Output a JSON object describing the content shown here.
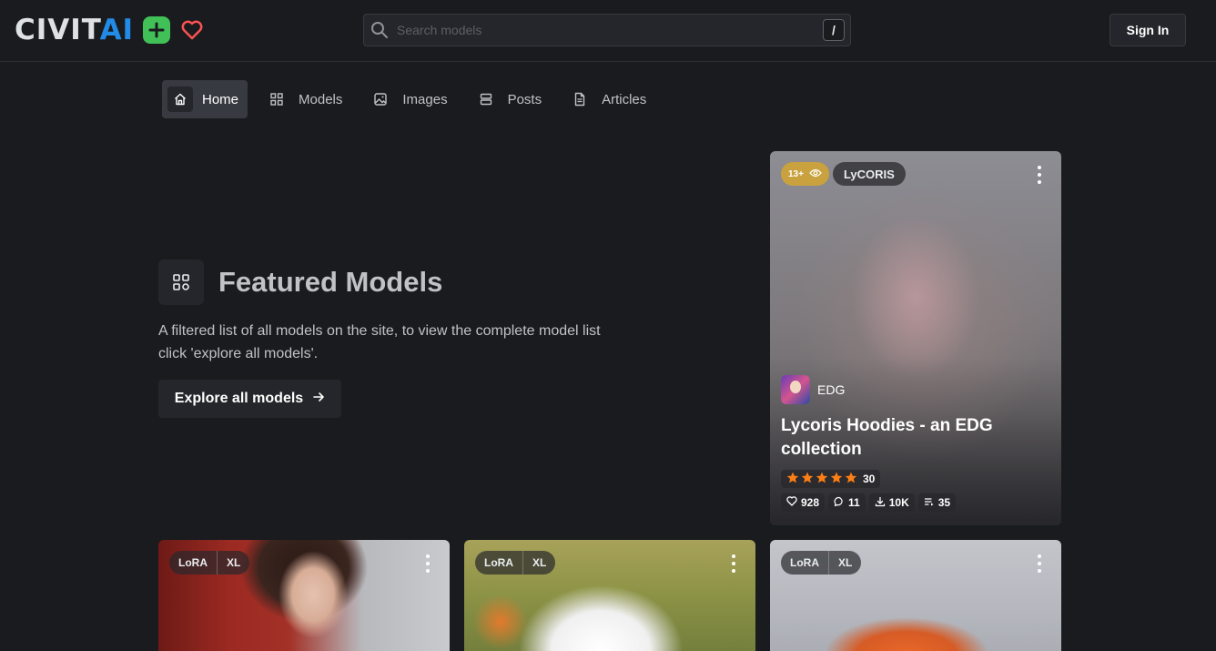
{
  "header": {
    "logo_text_main": "CIVIT",
    "logo_text_accent": "AI",
    "search_placeholder": "Search models",
    "search_shortcut": "/",
    "signin_label": "Sign In"
  },
  "nav": {
    "items": [
      {
        "label": "Home",
        "icon": "home-icon",
        "active": true
      },
      {
        "label": "Models",
        "icon": "grid-icon"
      },
      {
        "label": "Images",
        "icon": "photo-icon"
      },
      {
        "label": "Posts",
        "icon": "layout-rows-icon"
      },
      {
        "label": "Articles",
        "icon": "file-text-icon"
      }
    ]
  },
  "featured": {
    "title": "Featured Models",
    "description": "A filtered list of all models on the site, to view the complete model list click 'explore all models'.",
    "explore_label": "Explore all models"
  },
  "featured_card": {
    "age_rating": "13+",
    "type_badge": "LyCORIS",
    "creator": "EDG",
    "title": "Lycoris Hoodies - an EDG collection",
    "rating_stars": 5,
    "rating_count": "30",
    "stats": {
      "likes": "928",
      "comments": "11",
      "downloads": "10K",
      "tips": "35"
    }
  },
  "model_cards": [
    {
      "type": "LoRA",
      "base": "XL"
    },
    {
      "type": "LoRA",
      "base": "XL"
    },
    {
      "type": "LoRA",
      "base": "XL"
    }
  ],
  "colors": {
    "background": "#1a1b1e",
    "brand_blue": "#228be6",
    "create_green": "#40c057",
    "heart_red": "#fa5252",
    "star_orange": "#fd7e14",
    "age_badge": "#c9a13e"
  }
}
